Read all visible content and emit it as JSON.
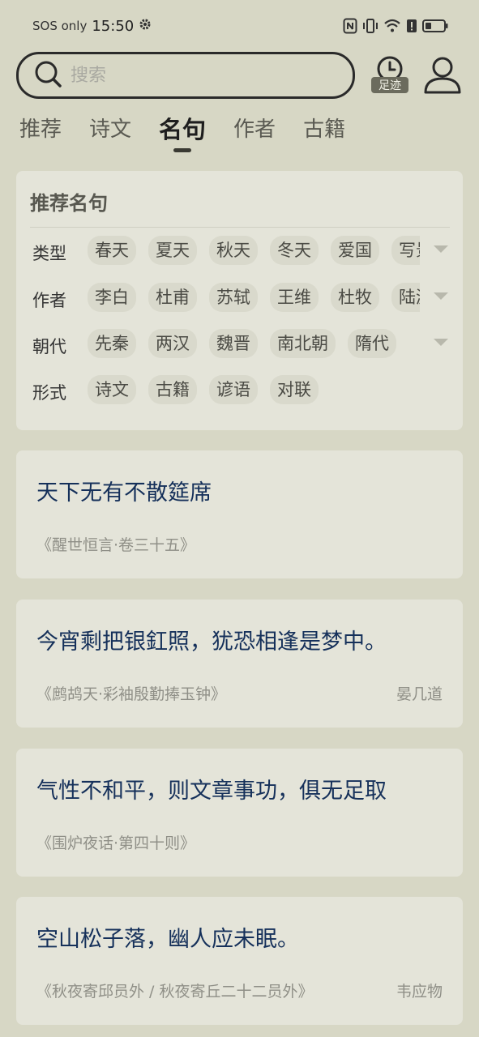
{
  "status": {
    "sos": "SOS only",
    "time": "15:50"
  },
  "search": {
    "placeholder": "搜索"
  },
  "header": {
    "history_label": "足迹"
  },
  "tabs": [
    {
      "label": "推荐"
    },
    {
      "label": "诗文"
    },
    {
      "label": "名句",
      "active": true
    },
    {
      "label": "作者"
    },
    {
      "label": "古籍"
    }
  ],
  "filter": {
    "title": "推荐名句",
    "rows": [
      {
        "label": "类型",
        "items": [
          "春天",
          "夏天",
          "秋天",
          "冬天",
          "爱国",
          "写景"
        ]
      },
      {
        "label": "作者",
        "items": [
          "李白",
          "杜甫",
          "苏轼",
          "王维",
          "杜牧",
          "陆游"
        ]
      },
      {
        "label": "朝代",
        "items": [
          "先秦",
          "两汉",
          "魏晋",
          "南北朝",
          "隋代"
        ]
      },
      {
        "label": "形式",
        "items": [
          "诗文",
          "古籍",
          "谚语",
          "对联"
        ]
      }
    ]
  },
  "quotes": [
    {
      "text": "天下无有不散筵席",
      "source": "《醒世恒言·卷三十五》",
      "author": ""
    },
    {
      "text": "今宵剩把银釭照，犹恐相逢是梦中。",
      "source": "《鹧鸪天·彩袖殷勤捧玉钟》",
      "author": "晏几道"
    },
    {
      "text": "气性不和平，则文章事功，俱无足取",
      "source": "《围炉夜话·第四十则》",
      "author": ""
    },
    {
      "text": "空山松子落，幽人应未眠。",
      "source": "《秋夜寄邱员外 / 秋夜寄丘二十二员外》",
      "author": "韦应物"
    }
  ],
  "colors": {
    "background": "#d7d7c5",
    "card": "#e4e4d9",
    "quote_text": "#15305a",
    "meta_text": "#8f8f87"
  }
}
